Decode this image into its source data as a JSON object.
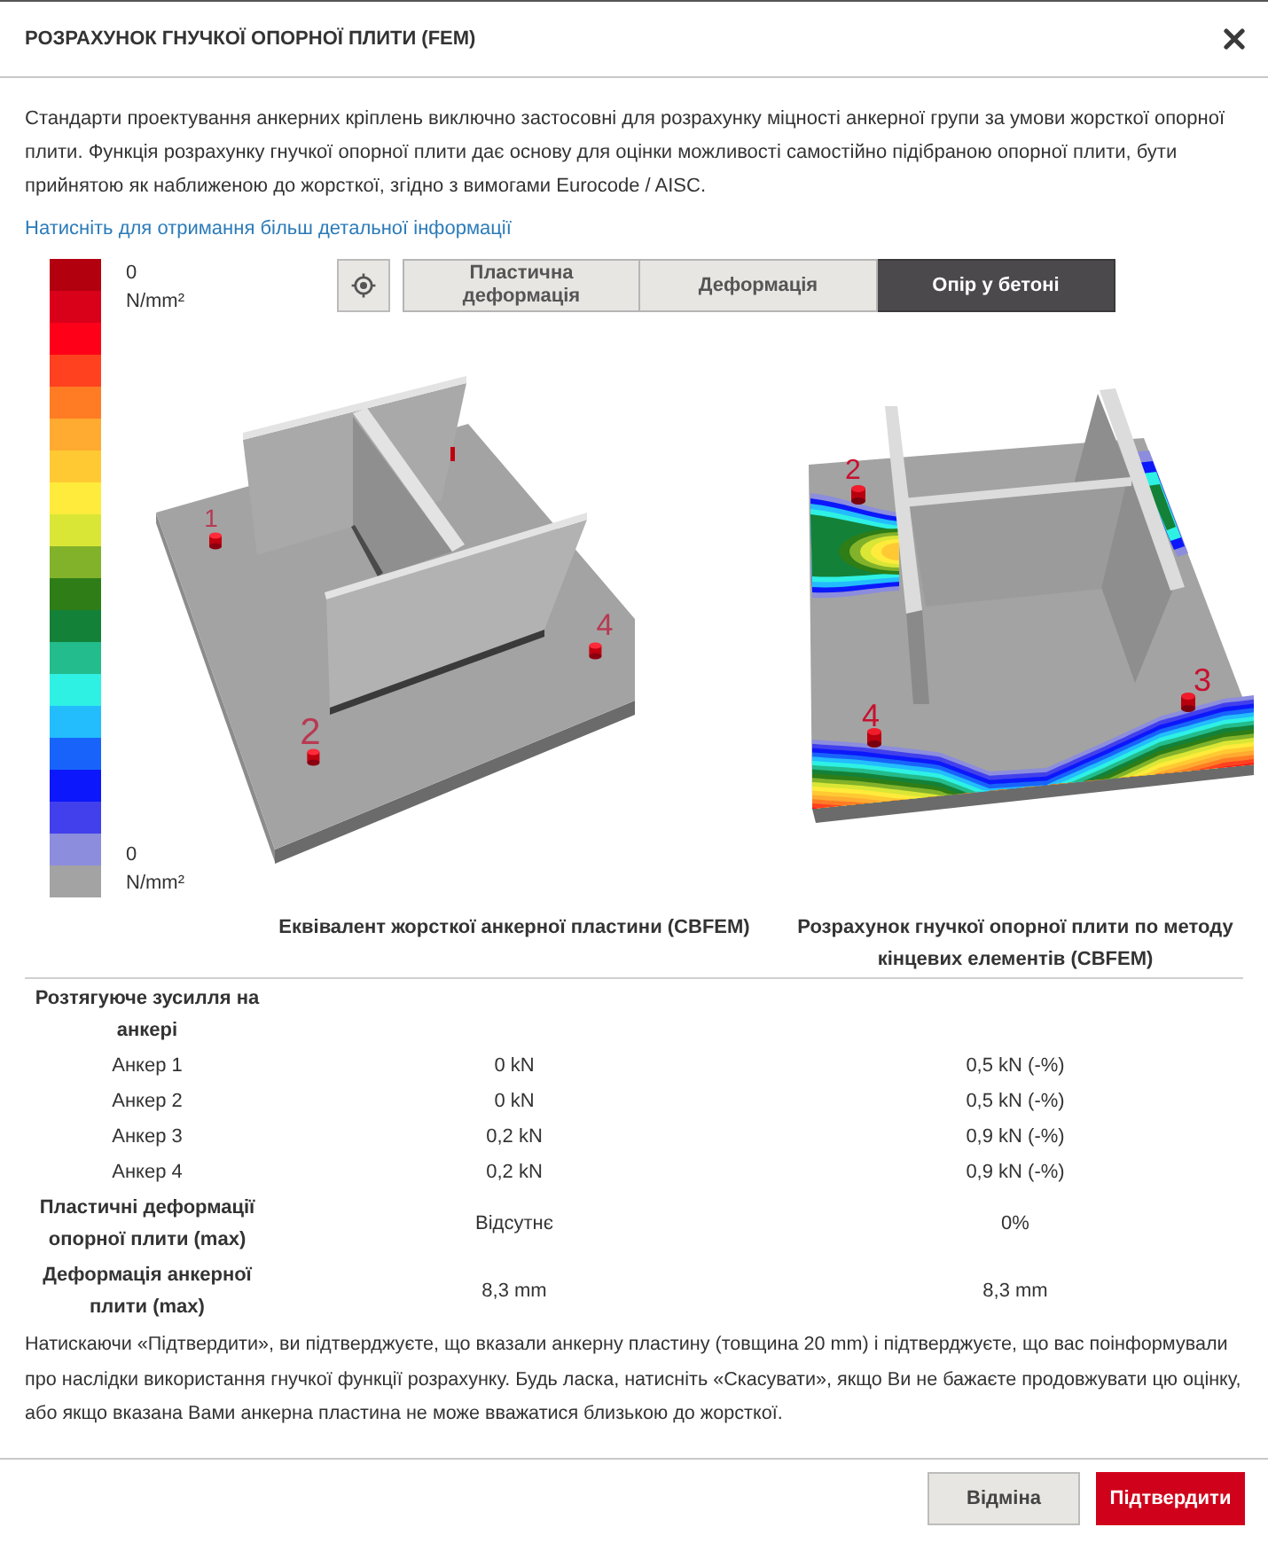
{
  "dialog": {
    "title": "РОЗРАХУНОК ГНУЧКОЇ ОПОРНОЇ ПЛИТИ (FEM)"
  },
  "intro": "Стандарти проектування анкерних кріплень виключно застосовні для розрахунку міцності анкерної групи за умови жорсткої опорної плити. Функція розрахунку гнучкої опорної плити дає основу для оцінки можливості самостійно підібраною опорної плити, бути прийнятою як наближеною до жорсткої, згідно з вимогами Eurocode / AISC.",
  "details_link": "Натисніть для отримання більш детальної інформації",
  "legend": {
    "top_value": "0",
    "top_unit": "N/mm²",
    "bottom_value": "0",
    "bottom_unit": "N/mm²"
  },
  "tabs": [
    {
      "label": "Пластична деформація",
      "selected": false
    },
    {
      "label": "Деформація",
      "selected": false
    },
    {
      "label": "Опір у бетоні",
      "selected": true
    }
  ],
  "views": [
    {
      "kind": "rigid",
      "anchors": [
        {
          "label": "1"
        },
        {
          "label": "2"
        },
        {
          "label": "4"
        }
      ]
    },
    {
      "kind": "flexible",
      "anchors": [
        {
          "label": "2"
        },
        {
          "label": "4"
        },
        {
          "label": "3"
        }
      ]
    }
  ],
  "table": {
    "columns": [
      "Еквівалент жорсткої анкерної пластини (CBFEM)",
      "Розрахунок гнучкої опорної плити по методу кінцевих елементів (CBFEM)"
    ],
    "rows": [
      {
        "kind": "heading",
        "label": "Розтягуюче зусилля на анкері"
      },
      {
        "kind": "item",
        "label": "Анкер 1",
        "values": [
          "0 kN",
          "0,5 kN (-%)"
        ]
      },
      {
        "kind": "item",
        "label": "Анкер 2",
        "values": [
          "0 kN",
          "0,5 kN (-%)"
        ]
      },
      {
        "kind": "item",
        "label": "Анкер 3",
        "values": [
          "0,2 kN",
          "0,9 kN (-%)"
        ]
      },
      {
        "kind": "item",
        "label": "Анкер 4",
        "values": [
          "0,2 kN",
          "0,9 kN (-%)"
        ]
      },
      {
        "kind": "heading",
        "label": "Пластичні деформації опорної плити (max)",
        "values": [
          "Відсутнє",
          "0%"
        ]
      },
      {
        "kind": "heading",
        "label": "Деформація анкерної плити (max)",
        "values": [
          "8,3 mm",
          "8,3 mm"
        ]
      }
    ]
  },
  "confirm_note": "Натискаючи «Підтвердити», ви підтверджуєте, що вказали анкерну пластину (товщина 20 mm) і підтверджуєте, що вас поінформували про наслідки використання гнучкої функції розрахунку. Будь ласка, натисніть «Скасувати», якщо Ви не бажаєте продовжувати цю оцінку, або якщо вказана Вами анкерна пластина не може вважатися близькою до жорсткої.",
  "buttons": [
    {
      "label": "Відміна",
      "kind": "secondary"
    },
    {
      "label": "Підтвердити",
      "kind": "primary"
    }
  ]
}
